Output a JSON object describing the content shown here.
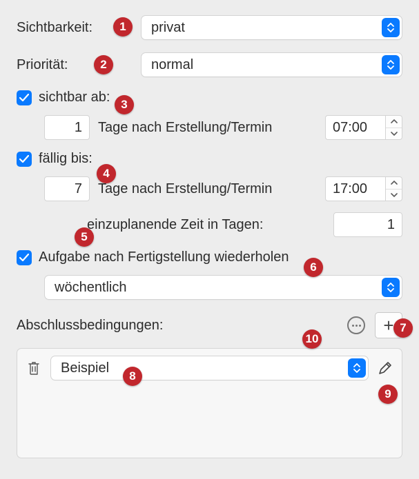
{
  "labels": {
    "visibility": "Sichtbarkeit:",
    "priority": "Priorität:",
    "visible_from": "sichtbar ab:",
    "due_until": "fällig bis:",
    "days_after": "Tage nach Erstellung/Termin",
    "planning_time": "einzuplanende Zeit in Tagen:",
    "repeat_task": "Aufgabe nach Fertigstellung wiederholen",
    "completion_conditions": "Abschlussbedingungen:"
  },
  "values": {
    "visibility": "privat",
    "priority": "normal",
    "visible_days": "1",
    "visible_time": "07:00",
    "due_days": "7",
    "due_time": "17:00",
    "planning_days": "1",
    "repeat_freq": "wöchentlich",
    "condition_example": "Beispiel"
  },
  "markers": {
    "m1": "1",
    "m2": "2",
    "m3": "3",
    "m4": "4",
    "m5": "5",
    "m6": "6",
    "m7": "7",
    "m8": "8",
    "m9": "9",
    "m10": "10"
  }
}
